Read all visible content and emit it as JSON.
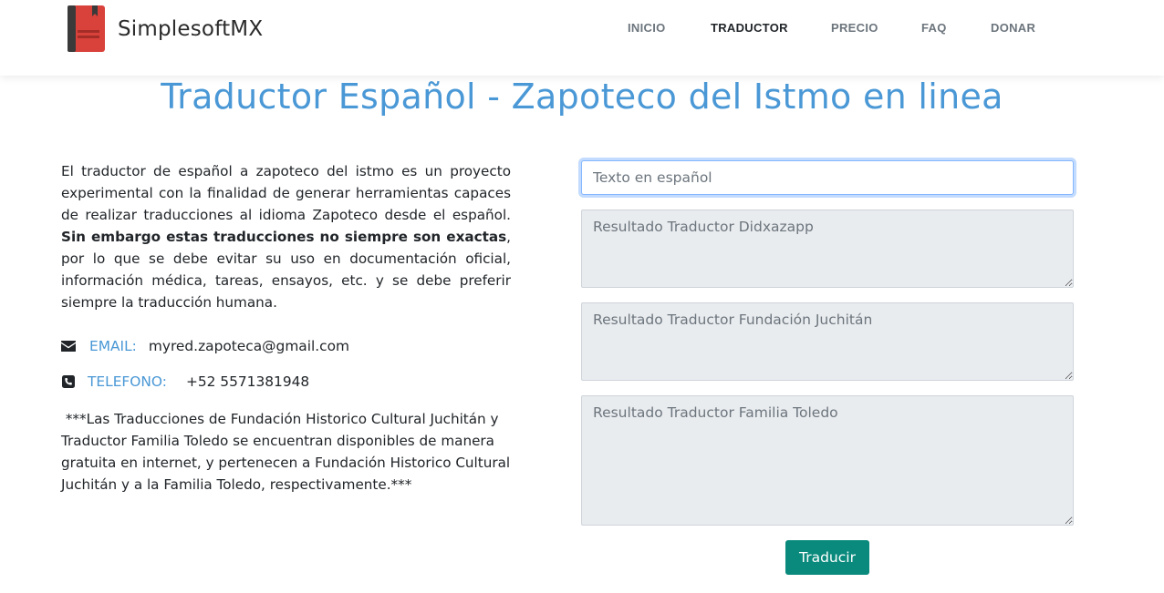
{
  "header": {
    "brand_name": "SimplesoftMX",
    "logo_icon": "red-book-icon",
    "nav": [
      {
        "label": "INICIO",
        "active": false
      },
      {
        "label": "TRADUCTOR",
        "active": true
      },
      {
        "label": "PRECIO",
        "active": false
      },
      {
        "label": "FAQ",
        "active": false
      },
      {
        "label": "DONAR",
        "active": false
      }
    ]
  },
  "main": {
    "title": "Traductor Español - Zapoteco del Istmo en linea",
    "intro": {
      "part1": "El traductor de español a zapoteco del istmo es un proyecto experimental con la finalidad de generar herramientas capaces de realizar traducciones al idioma Zapoteco desde el español. ",
      "bold": "Sin embargo estas traducciones no siempre son exactas",
      "part2": ", por lo que se debe evitar su uso en documentación oficial, información médica, tareas, ensayos, etc. y se debe preferir siempre la traducción humana."
    },
    "contact": {
      "email_icon": "envelope-icon",
      "email_label": "EMAIL:",
      "email_value": "myred.zapoteca@gmail.com",
      "phone_icon": "phone-square-icon",
      "phone_label": "TELEFONO:",
      "phone_value": "+52 5571381948"
    },
    "disclaimer": " ***Las Traducciones de Fundación Historico Cultural Juchitán y Traductor Familia Toledo se encuentran disponibles de manera gratuita en internet, y pertenecen a Fundación Historico Cultural Juchitán y a la Familia Toledo, respectivamente.***"
  },
  "form": {
    "input_value": "",
    "input_placeholder": "Texto en español",
    "result1_placeholder": "Resultado Traductor Didxazapp",
    "result2_placeholder": "Resultado Traductor Fundación Juchitán",
    "result3_placeholder": "Resultado Traductor Familia Toledo",
    "button_label": "Traducir"
  },
  "colors": {
    "accent": "#4a98d6",
    "button": "#0a8a7d",
    "logo_red": "#d9413b",
    "readonly_bg": "#e9ecef"
  }
}
